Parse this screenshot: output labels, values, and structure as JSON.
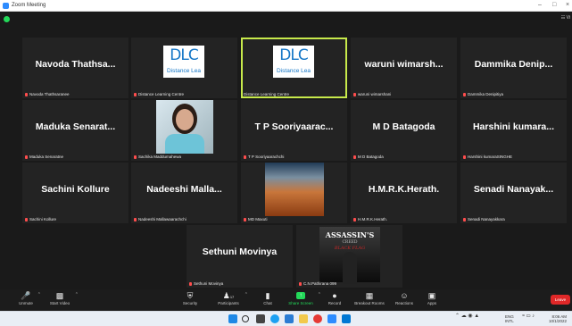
{
  "window": {
    "title": "Zoom Meeting",
    "minimize": "–",
    "maximize": "□",
    "close": "×"
  },
  "topbar": {
    "view_label": "☷ Vi"
  },
  "tiles": [
    {
      "name": "Navoda Thathsa...",
      "caption": "Navoda Thathsaranee"
    },
    {
      "caption": "Distance Learning Centre",
      "logo": "DLC",
      "logo_sub": "Distance Lea"
    },
    {
      "caption": "Distance Learning Centre",
      "logo": "DLC",
      "logo_sub": "Distance Lea"
    },
    {
      "name": "waruni wimarsh...",
      "caption": "waruni wimarshani"
    },
    {
      "name": "Dammika Denip...",
      "caption": "Dammika Denipitiya"
    },
    {
      "name": "Maduka Senarat...",
      "caption": "Maduka Senaratne"
    },
    {
      "caption": "Sachika Maddumahewa"
    },
    {
      "name": "T P Sooriyaarac...",
      "caption": "T P Sooriyaarachchi"
    },
    {
      "name": "M D Batagoda",
      "caption": "M D Batagoda"
    },
    {
      "name": "Harshini kumara...",
      "caption": "Harshini kumaraSINGHE"
    },
    {
      "name": "Sachini Kollure",
      "caption": "Sachini Kollure"
    },
    {
      "name": "Nadeeshi Malla...",
      "caption": "Nadeeshi Mallawaarachchi"
    },
    {
      "caption": "MD Maxuti"
    },
    {
      "name": "H.M.R.K.Herath.",
      "caption": "H.M.R.K.Herath."
    },
    {
      "name": "Senadi Nanayak...",
      "caption": "Senadi Nanayakkara"
    },
    {
      "name": "Sethuni Movinya",
      "caption": "Sethuni Movinya"
    },
    {
      "caption": "C.N.Pathirana 099",
      "book_title": "ASSASSIN'S",
      "book_sub": "CREED",
      "book_sub2": "BLACK FLAG"
    }
  ],
  "toolbar": {
    "unmute": "Unmute",
    "start_video": "Start Video",
    "security": "Security",
    "participants": "Participants",
    "participants_count": "17",
    "chat": "Chat",
    "share_screen": "Share Screen",
    "record": "Record",
    "breakout_rooms": "Breakout Rooms",
    "reactions": "Reactions",
    "apps": "Apps",
    "leave": "Leave"
  },
  "tray": {
    "lang": "ENG",
    "lang2": "INTL",
    "time": "8:06 AM",
    "date": "10/1/2022"
  },
  "colors": {
    "accent_green": "#23d959",
    "active_speaker": "#c7e94b",
    "leave_red": "#e02828",
    "dlc_blue": "#1476c6"
  }
}
